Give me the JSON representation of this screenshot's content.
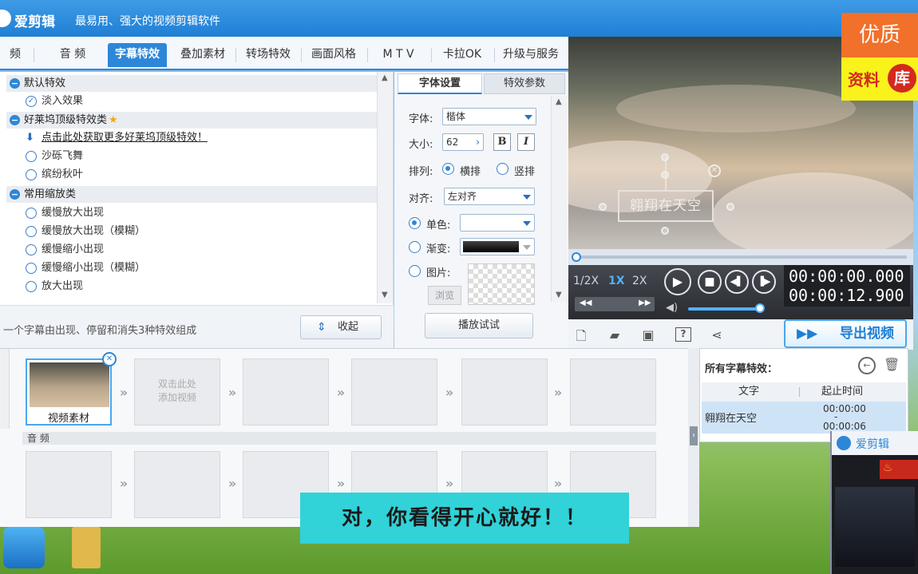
{
  "window": {
    "app_name": "爱剪辑",
    "slogan": "最易用、强大的视频剪辑软件"
  },
  "tabs": [
    {
      "label": "频"
    },
    {
      "label": "音  频"
    },
    {
      "label": "字幕特效"
    },
    {
      "label": "叠加素材"
    },
    {
      "label": "转场特效"
    },
    {
      "label": "画面风格"
    },
    {
      "label": "M T V"
    },
    {
      "label": "卡拉OK"
    },
    {
      "label": "升级与服务"
    }
  ],
  "effects": {
    "groups": [
      {
        "name": "默认特效",
        "items": [
          "淡入效果"
        ]
      },
      {
        "name": "好莱坞顶级特效类",
        "link": "点击此处获取更多好莱坞顶级特效！",
        "items": [
          "沙砾飞舞",
          "缤纷秋叶"
        ]
      },
      {
        "name": "常用缩放类",
        "items": [
          "缓慢放大出现",
          "缓慢放大出现（模糊）",
          "缓慢缩小出现",
          "缓慢缩小出现（模糊）",
          "放大出现"
        ]
      }
    ],
    "hint": "一个字幕由出现、停留和消失3种特效组成",
    "collapse_label": "收起"
  },
  "font_panel": {
    "tab_font": "字体设置",
    "tab_effect": "特效参数",
    "font_label": "字体:",
    "font_value": "楷体",
    "size_label": "大小:",
    "size_value": "62",
    "bold": "B",
    "italic": "I",
    "layout_label": "排列:",
    "horizontal": "横排",
    "vertical": "竖排",
    "align_label": "对齐:",
    "align_value": "左对齐",
    "solid": "单色:",
    "gradient": "渐变:",
    "image": "图片:",
    "browse": "浏览",
    "play_test": "播放试试"
  },
  "preview": {
    "subtitle_text": "翱翔在天空"
  },
  "player": {
    "speeds": [
      "1/2X",
      "1X",
      "2X"
    ],
    "time_now": "00:00:00.000",
    "time_total": "00:00:12.900",
    "export_label": "导出视频"
  },
  "timeline": {
    "clip1_label": "视频素材",
    "add_video": "双击此处\n添加视频",
    "audio_label": "音  频"
  },
  "subtitles": {
    "title": "所有字幕特效：",
    "col_text": "文字",
    "col_time": "起止时间",
    "rows": [
      {
        "text": "翱翔在天空",
        "start": "00:00:00",
        "end": "00:00:06"
      }
    ]
  },
  "overlay": {
    "caption": "对，你看得开心就好！！",
    "watermark_top": "优质",
    "watermark_bottom": "资料",
    "watermark_badge": "库",
    "popup_title": "爱剪辑"
  },
  "colors": {
    "accent": "#2d87d8",
    "caption_bg": "#31d2d8",
    "watermark_orange": "#f1702a",
    "watermark_yellow": "#f9f21b"
  }
}
